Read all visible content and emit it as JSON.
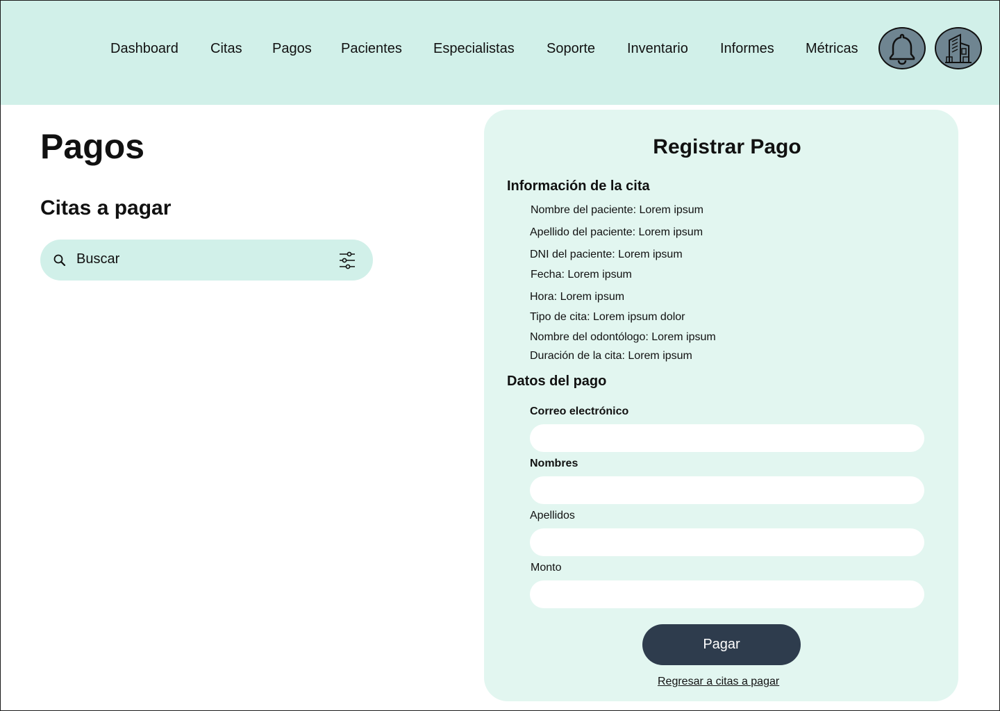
{
  "nav": {
    "items": [
      {
        "label": "Dashboard"
      },
      {
        "label": "Citas"
      },
      {
        "label": "Pagos"
      },
      {
        "label": "Pacientes"
      },
      {
        "label": "Especialistas"
      },
      {
        "label": "Soporte"
      },
      {
        "label": "Inventario"
      },
      {
        "label": "Informes"
      },
      {
        "label": "Métricas"
      }
    ],
    "icons": [
      "bell-icon",
      "building-icon"
    ],
    "colors": {
      "bar_bg": "#d1f0e9",
      "icon_bg": "#6f8591"
    }
  },
  "page": {
    "title": "Pagos",
    "section_title": "Citas a pagar"
  },
  "search": {
    "placeholder": "Buscar",
    "icons": [
      "search-icon",
      "filter-icon"
    ]
  },
  "form": {
    "title": "Registrar Pago",
    "info_heading": "Información de la cita",
    "info_lines": [
      "Nombre del paciente: Lorem ipsum",
      "Apellido del paciente: Lorem ipsum",
      "DNI del paciente: Lorem ipsum",
      "Fecha: Lorem ipsum",
      "Hora: Lorem ipsum",
      "Tipo de cita: Lorem ipsum dolor",
      "Nombre del odontólogo: Lorem ipsum",
      "Duración de la cita: Lorem ipsum"
    ],
    "payment_heading": "Datos del pago",
    "fields": [
      {
        "label": "Correo electrónico",
        "value": ""
      },
      {
        "label": "Nombres",
        "value": ""
      },
      {
        "label": "Apellidos",
        "value": ""
      },
      {
        "label": "Monto",
        "value": ""
      }
    ],
    "submit_label": "Pagar",
    "back_link": "Regresar a citas a pagar",
    "colors": {
      "panel_bg": "#e2f6f0",
      "button_bg": "#2e3c4d"
    }
  }
}
